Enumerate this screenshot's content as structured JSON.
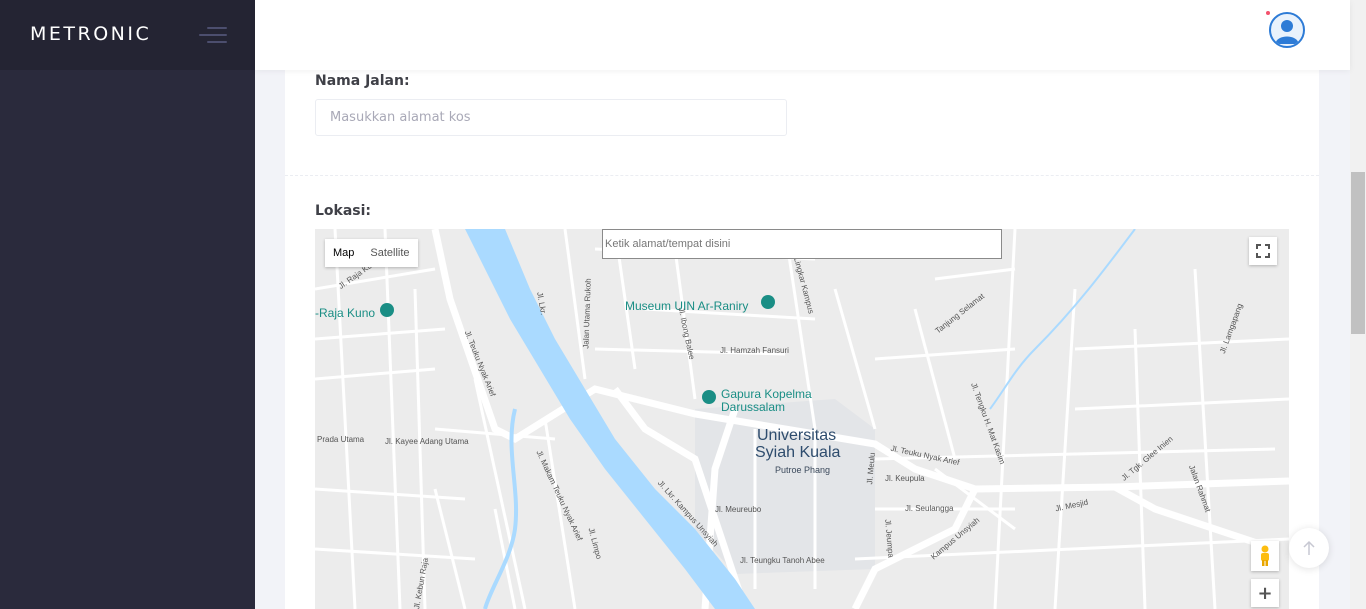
{
  "brand": {
    "name": "METRONIC"
  },
  "form": {
    "street_label": "Nama Jalan:",
    "street_placeholder": "Masukkan alamat kos",
    "location_label": "Lokasi:"
  },
  "map": {
    "search_placeholder": "Ketik alamat/tempat disini",
    "types": [
      "Map",
      "Satellite"
    ],
    "selected_type": "Map",
    "zoom_in_label": "+",
    "pois": {
      "raja_kuno": "-Raja Kuno",
      "museum": "Museum UIN Ar-Raniry",
      "gapura_1": "Gapura Kopelma",
      "gapura_2": "Darussalam"
    },
    "places": {
      "univ_1": "Universitas",
      "univ_2": "Syiah Kuala",
      "putroe": "Putroe Phang"
    },
    "streets": {
      "nyak_arief_w": "Jl. Teuku Nyak Arief",
      "nyak_arief_e": "Jl. Teuku Nyak Arief",
      "hamzah": "Jl. Hamzah Fansuri",
      "ibong": "Jl. Ibong Balee",
      "lkr": "Jl. Lkr.",
      "utama_rukoh": "Jalan Utama Rukoh",
      "lingkar_kampus": "Lingkar Kampus",
      "tanjung": "Tanjung Selamat",
      "prada": "Prada Utama",
      "kayee": "Jl. Kayee Adang Utama",
      "makam": "Jl. Makam Teuku Nyak Arief",
      "lkr_kampus": "Jl. Lkr. Kampus Unsyiah",
      "meureubo": "Jl. Meureubo",
      "keupula": "Jl. Keupula",
      "seulangga": "Jl. Seulangga",
      "tanoh_abee": "Jl. Teungku Tanoh Abee",
      "mesjid": "Jl. Mesjid",
      "tgk_glee": "Jl. Tgk. Glee Inien",
      "limpo": "Jl. Limpo",
      "kebun_raja": "Jl. Kebun Raja",
      "meulu": "Jl. Meulu",
      "jeumpa": "Jl. Jeumpa",
      "kampus_unsyiah": "Kampus Unsyiah",
      "rahmat": "Jalan Rahmat",
      "tengku_mat_kasim": "Jl. Tengku H. Mat Kasim",
      "angan": "Jl. Lamgapang",
      "rajakuno_top": "Jl. Raja Kuno"
    }
  },
  "colors": {
    "sidebar": "#2a2a3c",
    "accent": "#2d7bd6",
    "river": "#aadaff"
  }
}
